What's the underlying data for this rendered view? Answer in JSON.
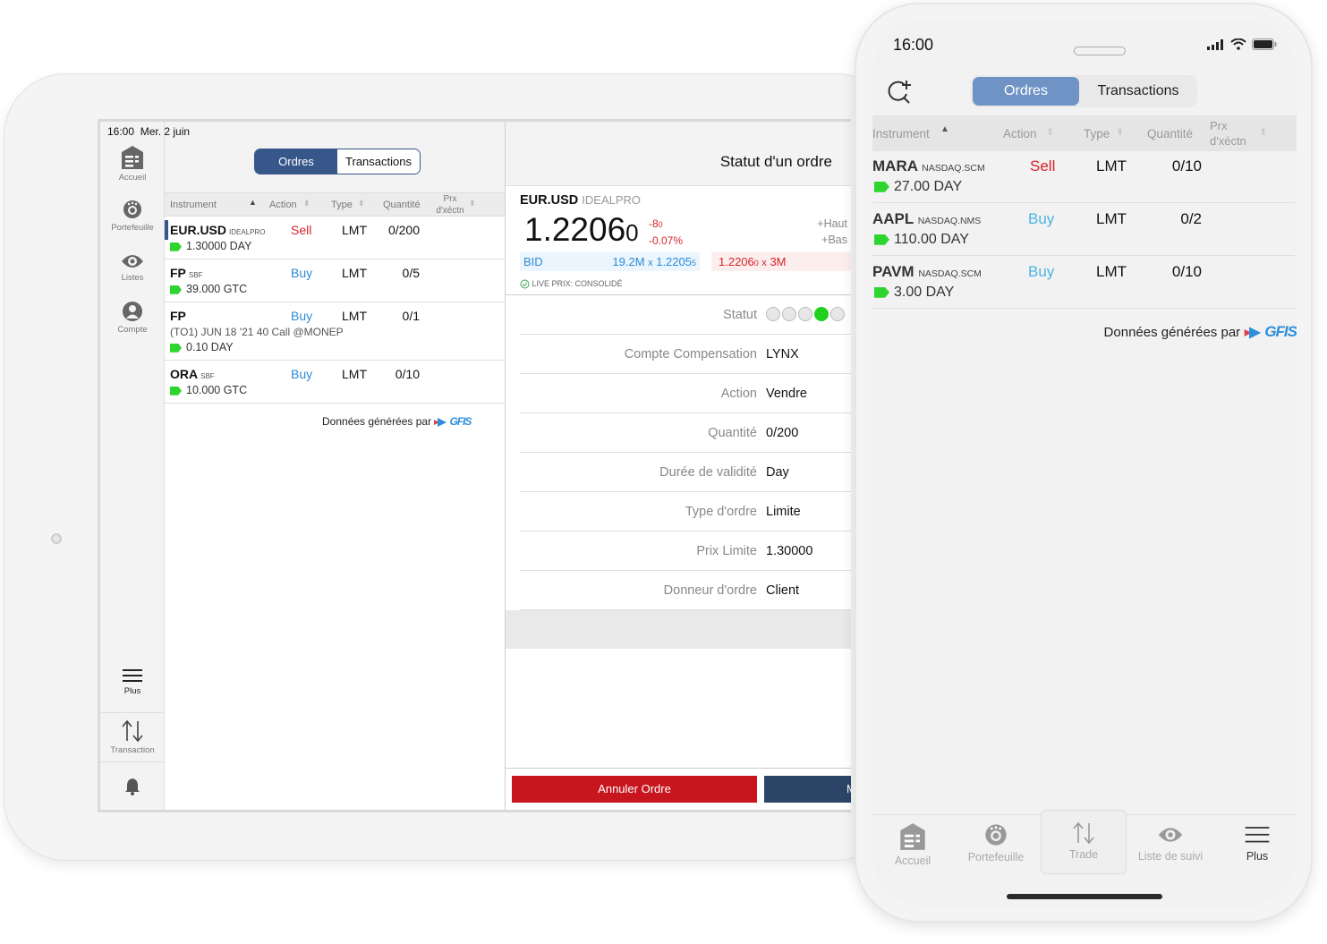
{
  "tablet": {
    "status_time": "16:00",
    "status_date": "Mer. 2 juin",
    "sidebar": {
      "items": [
        {
          "label": "Accueil",
          "icon": "home-icon"
        },
        {
          "label": "Portefeuille",
          "icon": "portfolio-icon"
        },
        {
          "label": "Listes",
          "icon": "eye-icon"
        },
        {
          "label": "Compte",
          "icon": "account-icon"
        }
      ],
      "more_label": "Plus",
      "transaction_label": "Transaction",
      "bell_icon": "bell-icon"
    },
    "orders": {
      "tabs": [
        {
          "label": "Ordres",
          "active": true
        },
        {
          "label": "Transactions",
          "active": false
        }
      ],
      "columns": [
        "Instrument",
        "Action",
        "Type",
        "Quantité",
        "Prx d'xéctn"
      ],
      "rows": [
        {
          "symbol": "EUR.USD",
          "exchange": "IDEALPRO",
          "action": "Sell",
          "type": "LMT",
          "qty": "0/200",
          "price_tif": "1.30000 DAY",
          "selected": true
        },
        {
          "symbol": "FP",
          "exchange": "SBF",
          "action": "Buy",
          "type": "LMT",
          "qty": "0/5",
          "price_tif": "39.000 GTC"
        },
        {
          "symbol": "FP",
          "exchange": "",
          "option_desc": "(TO1) JUN 18 '21 40 Call @MONEP",
          "action": "Buy",
          "type": "LMT",
          "qty": "0/1",
          "price_tif": "0.10 DAY"
        },
        {
          "symbol": "ORA",
          "exchange": "SBF",
          "action": "Buy",
          "type": "LMT",
          "qty": "0/10",
          "price_tif": "10.000 GTC"
        }
      ],
      "credit_text": "Données générées par",
      "credit_brand": "GFIS"
    },
    "detail": {
      "title": "Statut d'un ordre",
      "quote": {
        "symbol": "EUR.USD",
        "exchange": "IDEALPRO",
        "last": "1.2206",
        "last_small": "0",
        "change": "-8",
        "change_small": "0",
        "change_pct": "-0.07%",
        "high_label": "+Haut",
        "low_label": "+Bas",
        "bid_label": "BID",
        "bid_size": "19.2M",
        "bid_price": "1.2205",
        "bid_price_small": "5",
        "ask_price": "1.2206",
        "ask_price_small": "0",
        "ask_size": "3M",
        "live_label": "LIVE PRIX: CONSOLIDÉ"
      },
      "status_label": "Statut",
      "status_step": 4,
      "status_steps_total": 5,
      "fields": [
        {
          "label": "Compte Compensation",
          "value": "LYNX"
        },
        {
          "label": "Action",
          "value": "Vendre"
        },
        {
          "label": "Quantité",
          "value": "0/200"
        },
        {
          "label": "Durée de validité",
          "value": "Day"
        },
        {
          "label": "Type d'ordre",
          "value": "Limite"
        },
        {
          "label": "Prix Limite",
          "value": "1.30000"
        },
        {
          "label": "Donneur d'ordre",
          "value": "Client"
        }
      ],
      "cancel_label": "Annuler Ordre",
      "modify_label": "M"
    }
  },
  "phone": {
    "status_time": "16:00",
    "tabs": [
      {
        "label": "Ordres",
        "active": true
      },
      {
        "label": "Transactions",
        "active": false
      }
    ],
    "columns": [
      "Instrument",
      "Action",
      "Type",
      "Quantité",
      "Prx d'xéctn"
    ],
    "rows": [
      {
        "symbol": "MARA",
        "exchange": "NASDAQ.SCM",
        "action": "Sell",
        "type": "LMT",
        "qty": "0/10",
        "price_tif": "27.00 DAY"
      },
      {
        "symbol": "AAPL",
        "exchange": "NASDAQ.NMS",
        "action": "Buy",
        "type": "LMT",
        "qty": "0/2",
        "price_tif": "110.00 DAY"
      },
      {
        "symbol": "PAVM",
        "exchange": "NASDAQ.SCM",
        "action": "Buy",
        "type": "LMT",
        "qty": "0/10",
        "price_tif": "3.00 DAY"
      }
    ],
    "credit_text": "Données générées par",
    "credit_brand": "GFIS",
    "tabbar": [
      {
        "label": "Accueil",
        "icon": "home-icon"
      },
      {
        "label": "Portefeuille",
        "icon": "portfolio-icon"
      },
      {
        "label": "Trade",
        "icon": "trade-icon"
      },
      {
        "label": "Liste de suivi",
        "icon": "eye-icon"
      },
      {
        "label": "Plus",
        "icon": "menu-icon"
      }
    ]
  },
  "colors": {
    "sell": "#d5222b",
    "buy": "#2b8bd8",
    "accent": "#37578a",
    "phone_accent": "#6f93c4",
    "tag": "#2fd52f",
    "cancel": "#c8161f"
  }
}
